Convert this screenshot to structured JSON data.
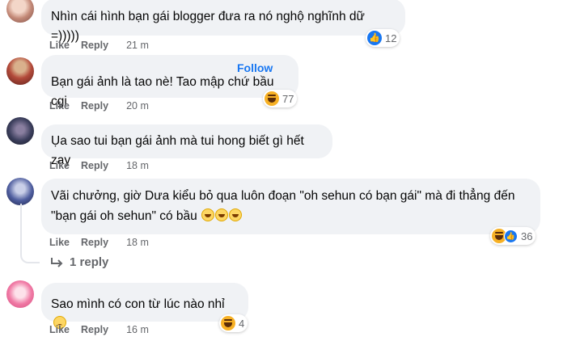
{
  "comments": [
    {
      "text": "Nhìn cái hình bạn gái blogger đưa ra nó nghộ nghĩnh dữ =)))))",
      "actions": {
        "like": "Like",
        "reply": "Reply"
      },
      "time": "21 m",
      "reaction": {
        "type": "like",
        "count": "12"
      }
    },
    {
      "follow": "Follow",
      "text": "Bạn gái ảnh là tao nè! Tao mập chứ bầu cgi",
      "actions": {
        "like": "Like",
        "reply": "Reply"
      },
      "time": "20 m",
      "reaction": {
        "type": "haha",
        "count": "77"
      }
    },
    {
      "text": "Ụa sao tui bạn gái ảnh mà tui hong biết gì hết zay",
      "actions": {
        "like": "Like",
        "reply": "Reply"
      },
      "time": "18 m"
    },
    {
      "text_line1": "Vãi chưởng, giờ Dưa kiểu bỏ qua luôn đoạn \"oh sehun có bạn gái\" mà đi thẳng đến",
      "text_line2": "\"bạn gái oh sehun\" có bầu",
      "actions": {
        "like": "Like",
        "reply": "Reply"
      },
      "time": "18 m",
      "reaction": {
        "type": "haha+like",
        "count": "36"
      },
      "replies": "1 reply"
    },
    {
      "text": "Sao mình có con từ lúc nào nhỉ",
      "actions": {
        "like": "Like",
        "reply": "Reply"
      },
      "time": "16 m",
      "reaction": {
        "type": "haha",
        "count": "4"
      }
    }
  ],
  "colors": {
    "bubble": "#f0f2f5",
    "link": "#1877f2",
    "meta": "#65676b"
  }
}
